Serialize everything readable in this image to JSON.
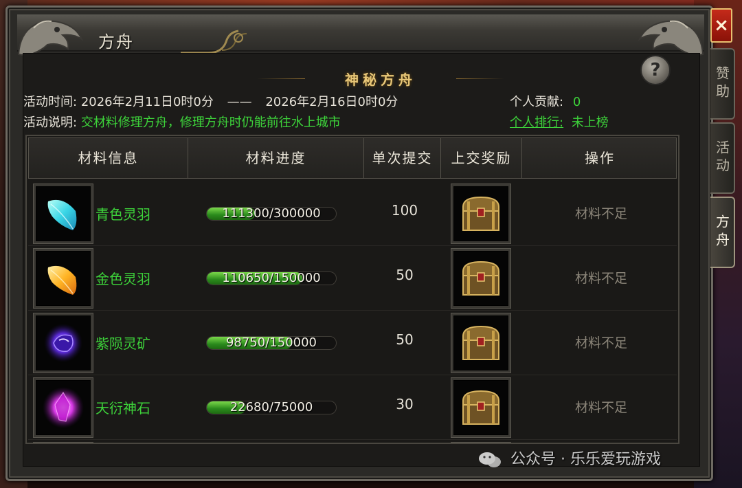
{
  "window": {
    "title": "方舟",
    "close_label": "×"
  },
  "side_tabs": [
    {
      "label": "赞助",
      "active": false
    },
    {
      "label": "活动",
      "active": false
    },
    {
      "label": "方舟",
      "active": true
    }
  ],
  "panel": {
    "title": "神秘方舟",
    "help_label": "?"
  },
  "activity": {
    "time_label": "活动时间:",
    "start": "2026年2月11日0时0分",
    "separator": "——",
    "end": "2026年2月16日0时0分",
    "desc_label": "活动说明:",
    "desc": "交材料修理方舟，修理方舟时仍能前往水上城市",
    "contrib_label": "个人贡献:",
    "contrib_value": "0",
    "rank_label": "个人排行:",
    "rank_value": "未上榜"
  },
  "table": {
    "headers": [
      "材料信息",
      "材料进度",
      "单次提交",
      "上交奖励",
      "操作"
    ],
    "rows": [
      {
        "icon": "cyan-feather-icon",
        "name": "青色灵羽",
        "progress_text": "111300/300000",
        "progress": 0.371,
        "per_submit": "100",
        "reward_icon": "treasure-chest-icon",
        "action": "材料不足"
      },
      {
        "icon": "gold-feather-icon",
        "name": "金色灵羽",
        "progress_text": "110650/150000",
        "progress": 0.738,
        "per_submit": "50",
        "reward_icon": "treasure-chest-icon",
        "action": "材料不足"
      },
      {
        "icon": "purple-ore-icon",
        "name": "紫陨灵矿",
        "progress_text": "98750/150000",
        "progress": 0.658,
        "per_submit": "50",
        "reward_icon": "treasure-chest-icon",
        "action": "材料不足"
      },
      {
        "icon": "magenta-stone-icon",
        "name": "天衍神石",
        "progress_text": "22680/75000",
        "progress": 0.302,
        "per_submit": "30",
        "reward_icon": "treasure-chest-icon",
        "action": "材料不足"
      }
    ]
  },
  "watermark": "公众号 · 乐乐爱玩游戏",
  "colors": {
    "accent_green": "#3dd23a",
    "title_gold": "#e8c778",
    "close_red": "#c42a1a"
  }
}
